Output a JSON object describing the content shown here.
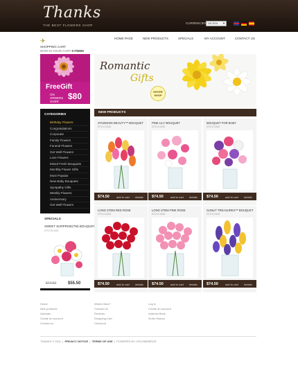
{
  "header": {
    "logo": "Thanks",
    "tagline": "THE BEST FLOWERS SHOP",
    "currencies_label": "CURRENCIES:",
    "currency_selected": "US DOL",
    "languages": [
      "english",
      "german",
      "spanish"
    ]
  },
  "cart": {
    "title": "SHOPPING CART",
    "sub_prefix": "NOW IN YOUR CART",
    "sub_count": "0 ITEMS"
  },
  "nav": [
    "HOME PAGE",
    "NEW PRODUCTS",
    "SPECIALS",
    "MY ACCOUNT",
    "CONTACT US"
  ],
  "banner": {
    "line1": "Romantic",
    "line2": "Gifts",
    "button": "ENTER SHOP"
  },
  "promo": {
    "headline": "FreeGift",
    "line": "ON ORDERS OVER",
    "price": "$80"
  },
  "categories": {
    "title": "CATEGORIES",
    "items": [
      "Birthday Flowers",
      "Congratulations",
      "Corporate",
      "Family Flowers",
      "Funeral Flowers",
      "Get Well Flowers",
      "Love Flowers",
      "Mixed Fresh Bouquets",
      "Monthly Flower Gifts",
      "Most Popular",
      "New Baby Bouquets",
      "Sympathy Gifts",
      "Weekly Flowers",
      "Anniversary",
      "Get Well Flowers"
    ]
  },
  "specials": {
    "title": "SPECIALS",
    "name": "SWEET SURPRISE(TM) BOUQUET",
    "code": "DT2-K1342",
    "old_price": "$74.50",
    "new_price": "$55.50"
  },
  "new_products": {
    "title": "NEW PRODUCTS",
    "add_label": "add to cart",
    "details_label": "details",
    "items": [
      {
        "name": "STUNNING BEAUTY™ BOUQUET",
        "code": "DT2-K1342",
        "price": "$74.50"
      },
      {
        "name": "PINK LILY BOUQUET",
        "code": "DT2-K1342",
        "price": "$74.50"
      },
      {
        "name": "BOUQUET FOR BABY",
        "code": "DT2-K1342",
        "price": "$74.50"
      },
      {
        "name": "LONG STEM RED ROSE",
        "code": "DT2-K1342",
        "price": "$74.50"
      },
      {
        "name": "LONG STEM PINK ROSE",
        "code": "DT2-K1342",
        "price": "$74.50"
      },
      {
        "name": "SUNLIT TREASURES™ BOUQUET",
        "code": "DT2-K1342",
        "price": "$74.50"
      }
    ]
  },
  "footer": {
    "col1": [
      "Home",
      "New products",
      "Specials",
      "Create an account",
      "Contact us"
    ],
    "col2": [
      "What's New?",
      "Contact Us",
      "Reviews",
      "Shopping Cart",
      "Checkout"
    ],
    "col3": [
      "Log in",
      "Create an account",
      "Address Book",
      "Order History"
    ],
    "copyright": "THANKS © 2011",
    "privacy": "PRIVACY NOTICE",
    "terms": "TERMS OF USE",
    "powered": "POWERED BY OSCOMMERCE"
  },
  "colors": {
    "header_bg": "#2b1d15",
    "accent_gold": "#cbb10d",
    "promo_pink": "#c21d8a",
    "bar_brown": "#3f2b1f"
  }
}
